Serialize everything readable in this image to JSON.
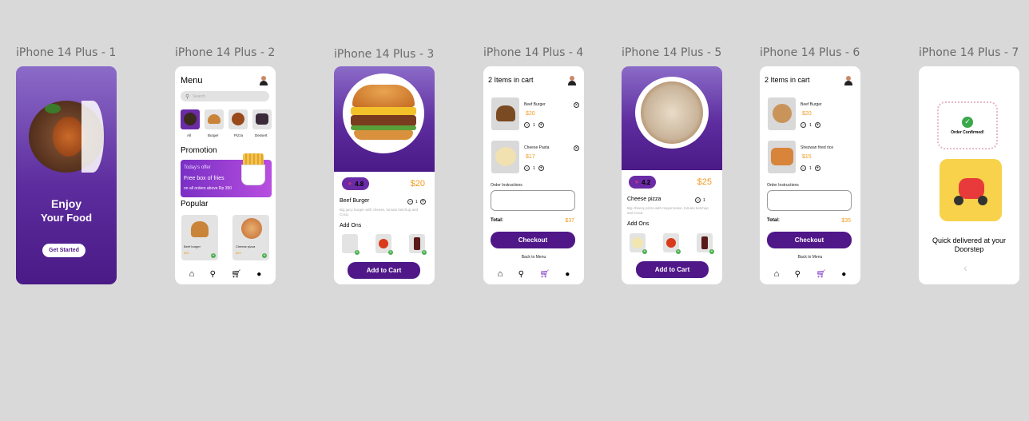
{
  "frames": [
    {
      "label": "iPhone 14 Plus - 1"
    },
    {
      "label": "iPhone 14 Plus - 2"
    },
    {
      "label": "iPhone 14 Plus - 3"
    },
    {
      "label": "iPhone 14 Plus - 4"
    },
    {
      "label": "iPhone 14 Plus - 5"
    },
    {
      "label": "iPhone 14 Plus - 6"
    },
    {
      "label": "iPhone 14 Plus - 7"
    }
  ],
  "splash": {
    "headline_1": "Enjoy",
    "headline_2": "Your Food",
    "cta": "Get Started"
  },
  "menu": {
    "title": "Menu",
    "search_placeholder": "Search",
    "categories": [
      "All",
      "Burger",
      "Pizza",
      "Dessert"
    ],
    "promotion_title": "Promotion",
    "promo_kicker": "Today's offer",
    "promo_title": "Free box of fries",
    "promo_sub": "on all orders above Rp 350",
    "popular_title": "Popular",
    "popular": [
      {
        "name": "Beef burger",
        "price": "$20"
      },
      {
        "name": "Cheese pizza",
        "price": "$25"
      }
    ]
  },
  "burger_detail": {
    "rating": "4.8",
    "price": "$20",
    "name": "Beef Burger",
    "qty": "1",
    "desc": "Big juicy burger with cheese, tomato ketchup and Coca.",
    "addons_title": "Add Ons",
    "cta": "Add to Cart"
  },
  "cart1": {
    "title": "2 Items in cart",
    "items": [
      {
        "name": "Beef Burger",
        "price": "$20",
        "qty": "1"
      },
      {
        "name": "Cheese Pasta",
        "price": "$17",
        "qty": "1"
      }
    ],
    "instructions": "Order Instructions",
    "total_label": "Total:",
    "total": "$37",
    "checkout": "Checkout",
    "back": "Back to Menu"
  },
  "pizza_detail": {
    "rating": "4.2",
    "price": "$25",
    "name": "Cheese pizza",
    "qty": "1",
    "desc": "Big cheesy pizza with mayonnaise, tomato ketchup and Coca.",
    "addons_title": "Add Ons",
    "cta": "Add to Cart"
  },
  "cart2": {
    "title": "2 Items in cart",
    "items": [
      {
        "name": "Beef Burger",
        "price": "$20",
        "qty": "1"
      },
      {
        "name": "Shezwan fried rice",
        "price": "$15",
        "qty": "1"
      }
    ],
    "instructions": "Order Instructions",
    "total_label": "Total:",
    "total": "$35",
    "checkout": "Checkout",
    "back": "Back to Menu"
  },
  "confirm": {
    "badge": "Order Confirmed!",
    "message": "Quick delivered at your Doorstep"
  },
  "colors": {
    "primary": "#4f1788",
    "price": "#f29a1f",
    "bg": "#d9d9d9"
  }
}
